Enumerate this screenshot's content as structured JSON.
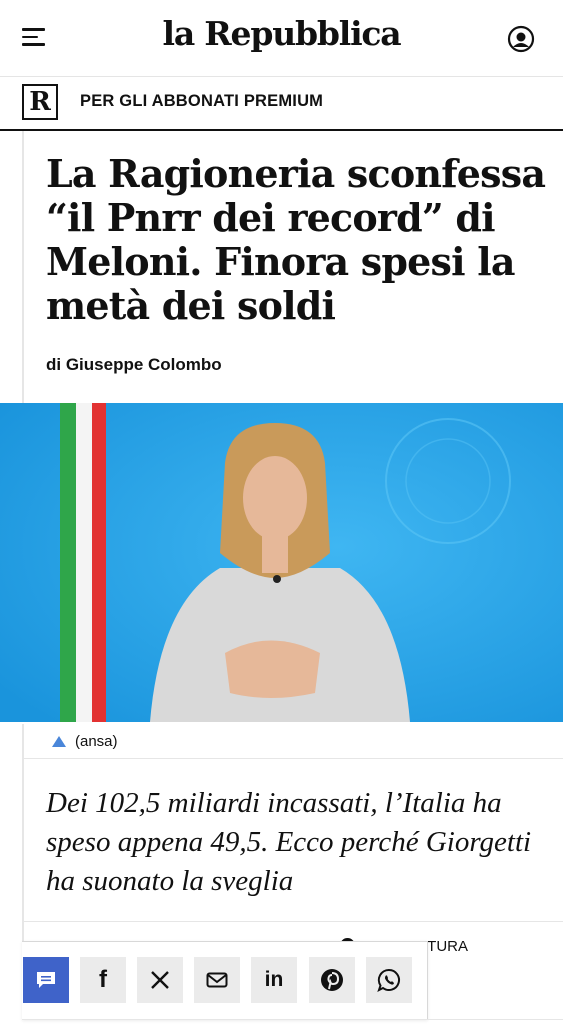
{
  "header": {
    "logo": "la Repubblica",
    "menu_icon": "hamburger-menu-icon",
    "user_icon": "user-account-icon"
  },
  "premium": {
    "badge": "R",
    "label": "PER GLI ABBONATI PREMIUM"
  },
  "article": {
    "headline": "La Ragioneria sconfessa “il Pnrr dei record” di Meloni. Finora spesi la metà dei soldi",
    "byline": "di Giuseppe Colombo",
    "caption": "(ansa)",
    "summary": "Dei 102,5 miliardi incassati, l’Italia ha speso appena 49,5. Ecco perché Giorgetti ha suonato la sveglia",
    "reading_time": "TI DI LETTURA"
  },
  "share": {
    "facebook_label": "f",
    "linkedin_label": "in",
    "icons": [
      "comment-icon",
      "facebook-icon",
      "x-icon",
      "mail-icon",
      "linkedin-icon",
      "pinterest-icon",
      "whatsapp-icon"
    ]
  },
  "colors": {
    "accent_blue": "#3f63c9",
    "photo_background": "#2aa8ea",
    "caption_triangle": "#4a86d9"
  }
}
